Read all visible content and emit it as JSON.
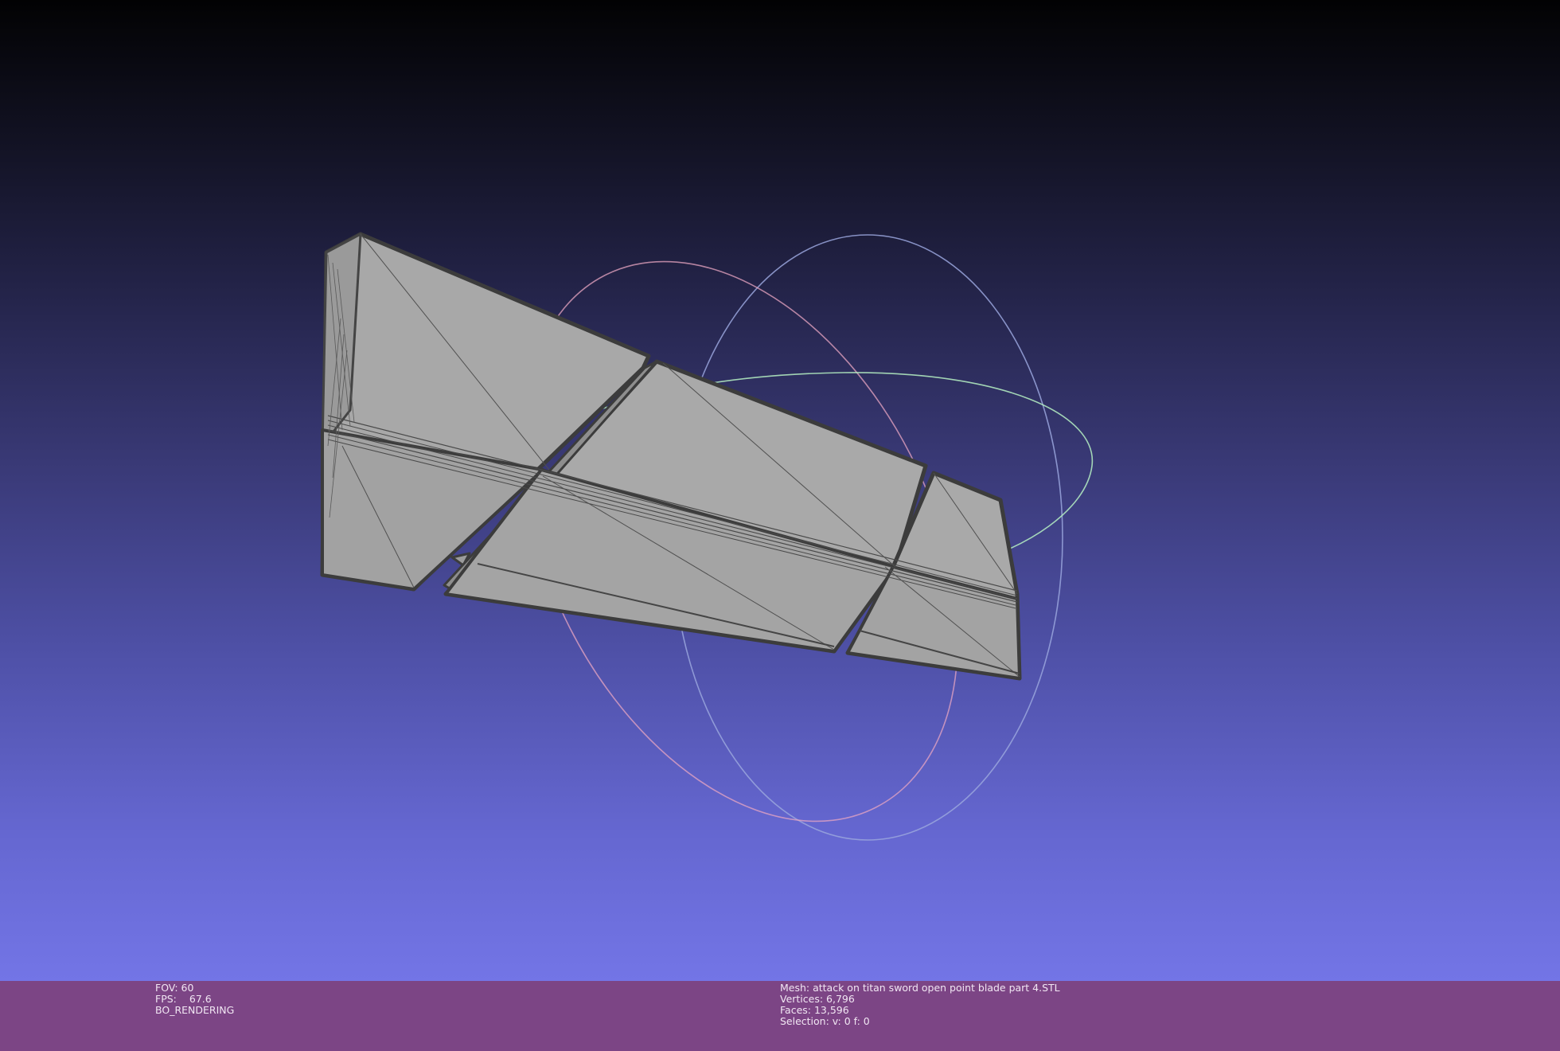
{
  "viewport": {
    "background_top": "#020203",
    "background_bottom": "#7375e6",
    "model_face_color": "#a5a5a5",
    "model_edge_color": "#3c3c3c",
    "trackball_colors": [
      "#9aa6dd",
      "#b6f1c3",
      "#e8a6c2"
    ]
  },
  "status_left": {
    "fov_text": "FOV: 60",
    "fps_label": "FPS:",
    "fps_value": "67.6",
    "render_mode": "BO_RENDERING"
  },
  "status_right": {
    "mesh": "Mesh: attack on titan sword open point blade part 4.STL",
    "vertices": "Vertices: 6,796",
    "faces": "Faces: 13,596",
    "selection": "Selection: v: 0 f: 0"
  },
  "status_bar_color": "#7c4585"
}
